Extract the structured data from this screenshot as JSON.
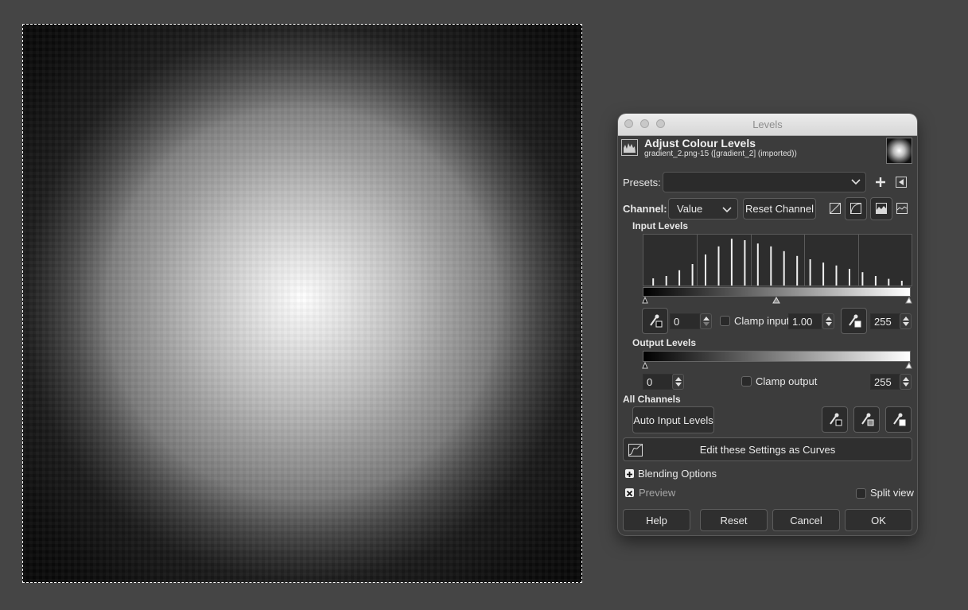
{
  "dialog": {
    "window_title": "Levels",
    "header_title": "Adjust Colour Levels",
    "header_subtitle": "gradient_2.png-15 ([gradient_2] (imported))",
    "presets": {
      "label": "Presets:",
      "value": ""
    },
    "channel": {
      "label": "Channel:",
      "value": "Value",
      "reset_label": "Reset Channel"
    },
    "input_levels": {
      "heading": "Input Levels",
      "low_value": "0",
      "gamma_value": "1.00",
      "high_value": "255",
      "clamp_label": "Clamp input"
    },
    "output_levels": {
      "heading": "Output Levels",
      "low_value": "0",
      "high_value": "255",
      "clamp_label": "Clamp output"
    },
    "all_channels": {
      "heading": "All Channels",
      "auto_label": "Auto Input Levels"
    },
    "curves_label": "Edit these Settings as Curves",
    "blending_label": "Blending Options",
    "preview_label": "Preview",
    "split_view_label": "Split view",
    "buttons": {
      "help": "Help",
      "reset": "Reset",
      "cancel": "Cancel",
      "ok": "OK"
    }
  },
  "histogram": {
    "bins": [
      0.15,
      0.2,
      0.32,
      0.45,
      0.65,
      0.82,
      0.98,
      0.95,
      0.88,
      0.82,
      0.72,
      0.62,
      0.55,
      0.48,
      0.42,
      0.35,
      0.28,
      0.2,
      0.14,
      0.1
    ]
  },
  "colors": {
    "dialog_bg": "#3c3c3c",
    "field_bg": "#2b2b2b",
    "canvas_bg": "#454545"
  }
}
